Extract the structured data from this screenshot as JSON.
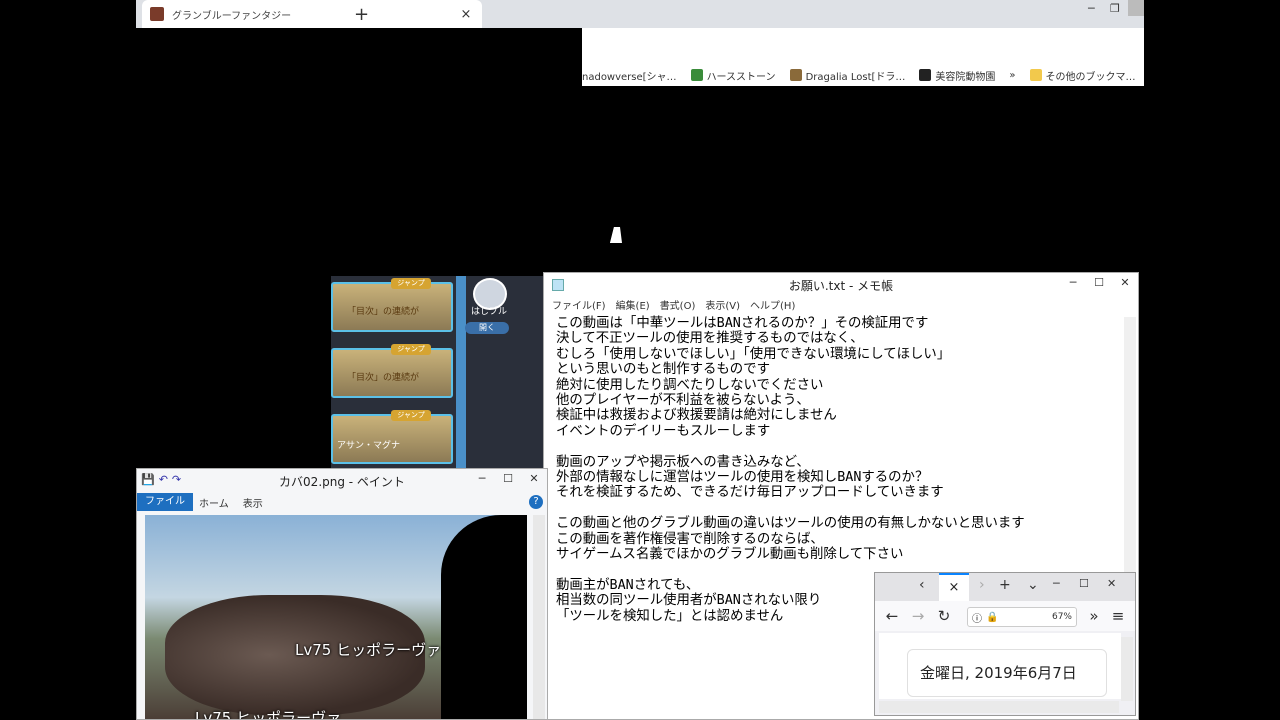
{
  "chrome": {
    "tab_title": "グランブルーファンタジー",
    "bookmarks": [
      "nadowverse[シャ…",
      "ハースストーン",
      "Dragalia Lost[ドラ…",
      "美容院動物園",
      "»",
      "その他のブックマ…"
    ]
  },
  "game": {
    "badge": "ジャンプ",
    "panel_text": "「目次」の連続が",
    "side_label": "はじブル",
    "side_button": "開く",
    "bottom_text": "アサン・マグナ"
  },
  "notepad": {
    "title": "お願い.txt - メモ帳",
    "menu": [
      "ファイル(F)",
      "編集(E)",
      "書式(O)",
      "表示(V)",
      "ヘルプ(H)"
    ],
    "lines": [
      "この動画は「中華ツールはBANされるのか？」その検証用です",
      "決して不正ツールの使用を推奨するものではなく、",
      "むしろ「使用しないでほしい」「使用できない環境にしてほしい」",
      "という思いのもと制作するものです",
      "絶対に使用したり調べたりしないでください",
      "他のプレイヤーが不利益を被らないよう、",
      "検証中は救援および救援要請は絶対にしません",
      "イベントのデイリーもスルーします",
      "",
      "動画のアップや掲示板への書き込みなど、",
      "外部の情報なしに運営はツールの使用を検知しBANするのか？",
      "それを検証するため、できるだけ毎日アップロードしていきます",
      "",
      "この動画と他のグラブル動画の違いはツールの使用の有無しかないと思います",
      "この動画を著作権侵害で削除するのならば、",
      "サイゲームス名義でほかのグラブル動画も削除して下さい",
      "",
      "動画主がBANされても、",
      "相当数の同ツール使用者がBANされない限り",
      "「ツールを検知した」とは認めません"
    ]
  },
  "paint": {
    "title": "カバ02.png - ペイント",
    "tabs": [
      "ファイル",
      "ホーム",
      "表示"
    ],
    "labels": [
      "Lv75 ヒッポラーヴァ",
      "Lv75 ヒッポラーヴァ"
    ]
  },
  "firefox": {
    "zoom": "67%",
    "date": "金曜日, 2019年6月7日"
  }
}
